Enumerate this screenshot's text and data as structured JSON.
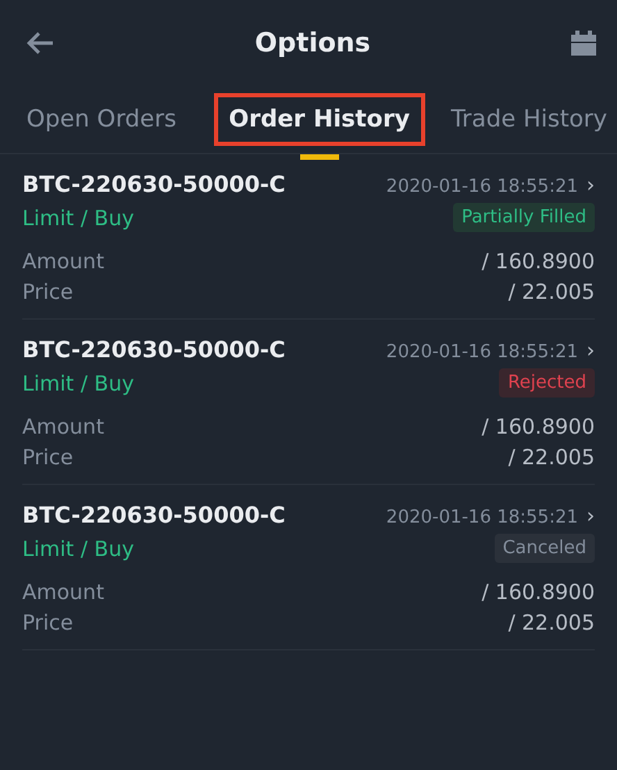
{
  "header": {
    "title": "Options"
  },
  "tabs": [
    {
      "label": "Open Orders",
      "selected": false,
      "highlighted": false
    },
    {
      "label": "Order History",
      "selected": true,
      "highlighted": true
    },
    {
      "label": "Trade History",
      "selected": false,
      "highlighted": false
    }
  ],
  "orders": [
    {
      "symbol": "BTC-220630-50000-C",
      "time": "2020-01-16 18:55:21",
      "chevron": "›",
      "type": "Limit / Buy",
      "status": {
        "label": "Partially Filled",
        "kind": "filled"
      },
      "amount_label": "Amount",
      "amount": "/ 160.8900",
      "price_label": "Price",
      "price": "/ 22.005"
    },
    {
      "symbol": "BTC-220630-50000-C",
      "time": "2020-01-16 18:55:21",
      "chevron": "›",
      "type": "Limit / Buy",
      "status": {
        "label": "Rejected",
        "kind": "rejected"
      },
      "amount_label": "Amount",
      "amount": "/ 160.8900",
      "price_label": "Price",
      "price": "/ 22.005"
    },
    {
      "symbol": "BTC-220630-50000-C",
      "time": "2020-01-16 18:55:21",
      "chevron": "›",
      "type": "Limit / Buy",
      "status": {
        "label": "Canceled",
        "kind": "canceled"
      },
      "amount_label": "Amount",
      "amount": "/ 160.8900",
      "price_label": "Price",
      "price": "/ 22.005"
    }
  ]
}
